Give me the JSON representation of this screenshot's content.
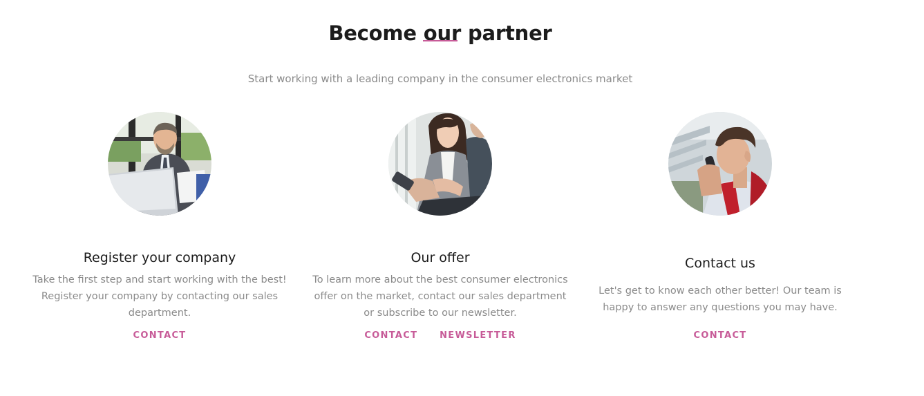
{
  "section": {
    "title": "Become our partner",
    "subtitle": "Start working with a leading company in the consumer electronics market",
    "accent_color": "#c75b98"
  },
  "cards": [
    {
      "image": "businessman-with-laptop-photo",
      "title": "Register your company",
      "text_lines": [
        "Take the first step and start working with the best!",
        "Register your company by contacting our sales",
        "department."
      ],
      "links": [
        "CONTACT"
      ]
    },
    {
      "image": "businesswoman-with-phone-photo",
      "title": "Our offer",
      "text_lines": [
        "To learn more about the best consumer electronics",
        "offer on the market, contact our sales department",
        "or subscribe to our newsletter."
      ],
      "links": [
        "CONTACT",
        "NEWSLETTER"
      ]
    },
    {
      "image": "man-on-phone-photo",
      "title": "Contact us",
      "text_lines": [
        "Let's get to know each other better! Our team is",
        "happy to answer any questions you may have."
      ],
      "links": [
        "CONTACT"
      ]
    }
  ]
}
